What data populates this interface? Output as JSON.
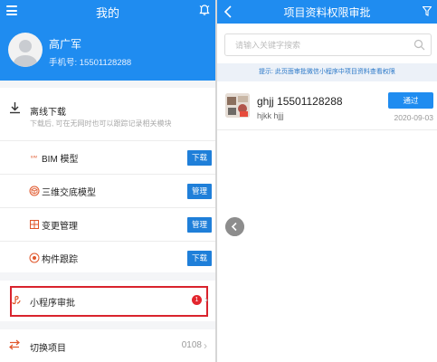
{
  "left": {
    "title": "我的",
    "profile": {
      "name": "高广军",
      "phone": "手机号: 15501128288"
    },
    "offline": {
      "title": "离线下载",
      "desc": "下载后, 可在无网时也可以跟踪记录相关模块"
    },
    "items": [
      {
        "label": "BIM 模型",
        "button": "下载",
        "icon": "bim-icon"
      },
      {
        "label": "三维交底模型",
        "button": "管理",
        "icon": "cube-icon"
      },
      {
        "label": "变更管理",
        "button": "管理",
        "icon": "change-icon"
      },
      {
        "label": "构件跟踪",
        "button": "下载",
        "icon": "track-icon"
      }
    ],
    "mini_program": {
      "label": "小程序审批",
      "badge": "1"
    },
    "switch_project": {
      "label": "切换项目",
      "value": "0108"
    },
    "colors": {
      "header": "#1f8cf0",
      "button": "#1f7fd9",
      "highlight": "#d9232d",
      "badge": "#e3262e"
    }
  },
  "right": {
    "title": "项目资料权限审批",
    "search": {
      "placeholder": "请输入关键字搜索",
      "value": ""
    },
    "tip": "提示: 此页面审批微信小程序中项目资料查看权限",
    "record": {
      "name": "ghjj 15501128288",
      "sub": "hjkk hjjj",
      "button": "通过",
      "date": "2020-09-03"
    },
    "colors": {
      "header": "#1f8cf0",
      "tip_bg": "#ecf1f8",
      "tip_text": "#2a78c8"
    }
  }
}
